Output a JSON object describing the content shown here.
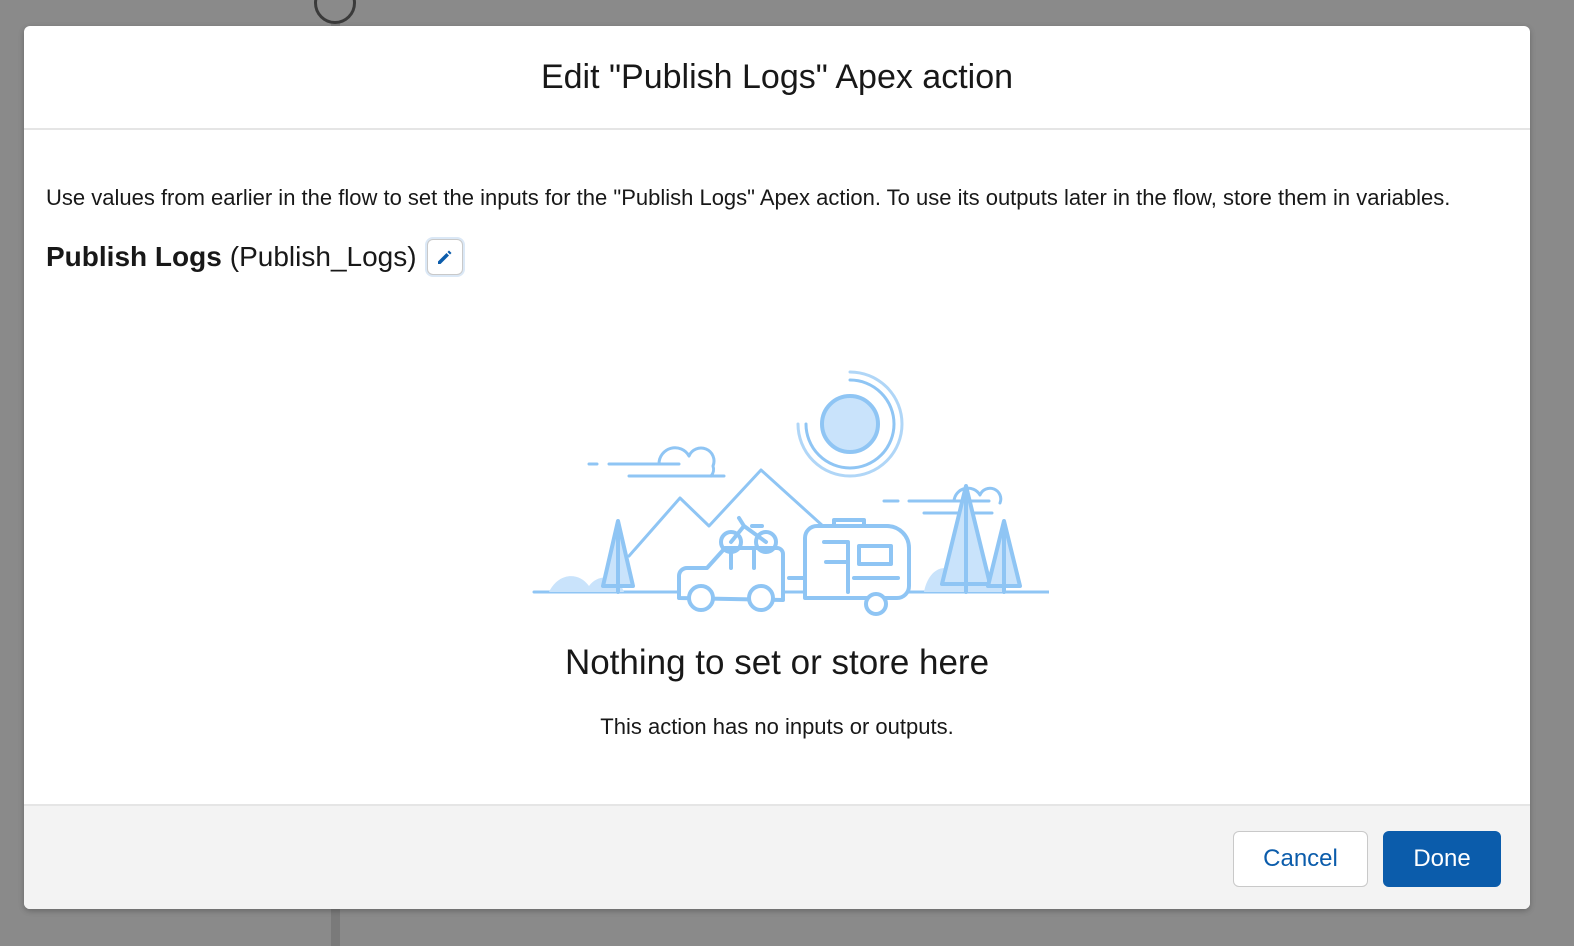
{
  "modal": {
    "title": "Edit \"Publish Logs\" Apex action",
    "description": "Use values from earlier in the flow to set the inputs for the \"Publish Logs\" Apex action. To use its outputs later in the flow, store them in variables.",
    "action_label": "Publish Logs",
    "action_api_name": "(Publish_Logs)",
    "edit_icon": "pencil-icon",
    "empty_state": {
      "illustration": "camping-trailer-illustration",
      "title": "Nothing to set or store here",
      "subtitle": "This action has no inputs or outputs."
    },
    "footer": {
      "cancel_label": "Cancel",
      "done_label": "Done"
    }
  },
  "colors": {
    "brand": "#0b5cab",
    "illustration": "#8fc5f4",
    "backdrop": "#8a8a8a"
  }
}
